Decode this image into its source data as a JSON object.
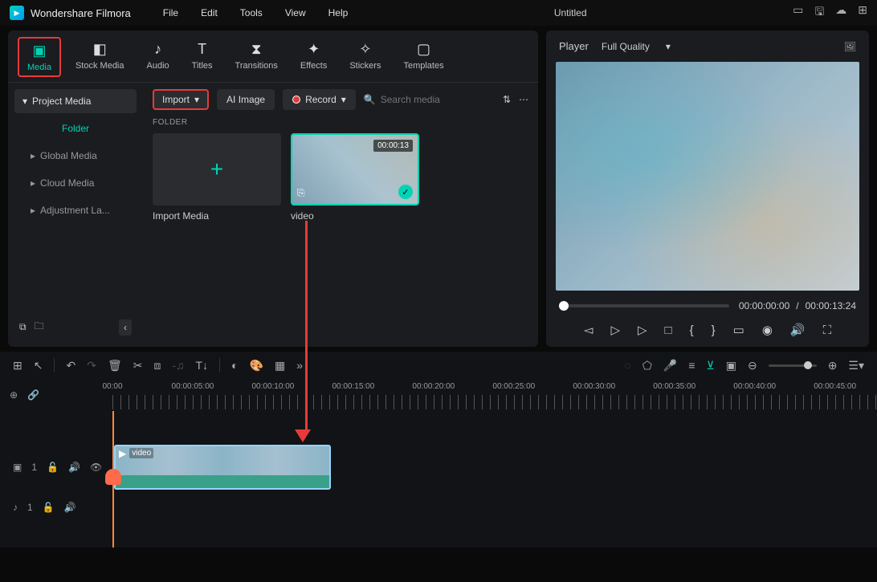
{
  "app": {
    "title": "Wondershare Filmora"
  },
  "menu": [
    "File",
    "Edit",
    "Tools",
    "View",
    "Help"
  ],
  "project": {
    "title": "Untitled"
  },
  "tabs": [
    {
      "label": "Media",
      "active": true
    },
    {
      "label": "Stock Media"
    },
    {
      "label": "Audio"
    },
    {
      "label": "Titles"
    },
    {
      "label": "Transitions"
    },
    {
      "label": "Effects"
    },
    {
      "label": "Stickers"
    },
    {
      "label": "Templates"
    }
  ],
  "sidebar": {
    "project_media": "Project Media",
    "folder": "Folder",
    "items": [
      "Global Media",
      "Cloud Media",
      "Adjustment La..."
    ]
  },
  "toolbar": {
    "import": "Import",
    "ai_image": "AI Image",
    "record": "Record",
    "search_placeholder": "Search media"
  },
  "content": {
    "folder_header": "FOLDER",
    "import_label": "Import Media",
    "video": {
      "label": "video",
      "duration": "00:00:13"
    }
  },
  "player": {
    "label": "Player",
    "quality": "Full Quality",
    "current": "00:00:00:00",
    "sep": "/",
    "total": "00:00:13:24"
  },
  "ruler": [
    "00:00",
    "00:00:05:00",
    "00:00:10:00",
    "00:00:15:00",
    "00:00:20:00",
    "00:00:25:00",
    "00:00:30:00",
    "00:00:35:00",
    "00:00:40:00",
    "00:00:45:00"
  ],
  "tracks": {
    "video_head": "1",
    "audio_head": "1",
    "clip_label": "video"
  }
}
